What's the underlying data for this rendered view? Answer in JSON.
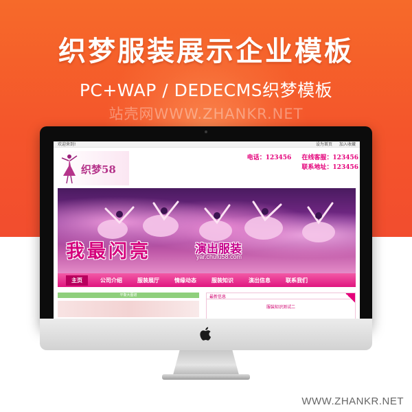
{
  "banner": {
    "headline": "织梦服装展示企业模板",
    "subline": "PC+WAP / DEDECMS织梦模板",
    "watermark": "站壳网WWW.ZHANKR.NET"
  },
  "footer": {
    "url": "WWW.ZHANKR.NET"
  },
  "site": {
    "topbar": {
      "welcome": "欢迎来到!",
      "links": [
        "设为首页",
        "加入收藏"
      ]
    },
    "logo_text": "织梦58",
    "contact": {
      "phone_label": "电话：",
      "phone": "123456",
      "online_label": "在线客服：",
      "online": "123456",
      "address_label": "联系地址：",
      "address": "123456"
    },
    "hero": {
      "title": "我最闪亮",
      "subtitle": "演出服装",
      "url": "yar.chufu58.com"
    },
    "nav": [
      "主页",
      "公司介绍",
      "服装展厅",
      "情缘动态",
      "服装知识",
      "演出信息",
      "联系我们"
    ],
    "left_panel": {
      "title": "平衡大图谱"
    },
    "right_panel": {
      "title": "最新信息",
      "item": "服装知识测试二"
    }
  },
  "colors": {
    "banner": "#f4552b",
    "brand_pink": "#e4007a",
    "nav_active": "#b8005e"
  }
}
